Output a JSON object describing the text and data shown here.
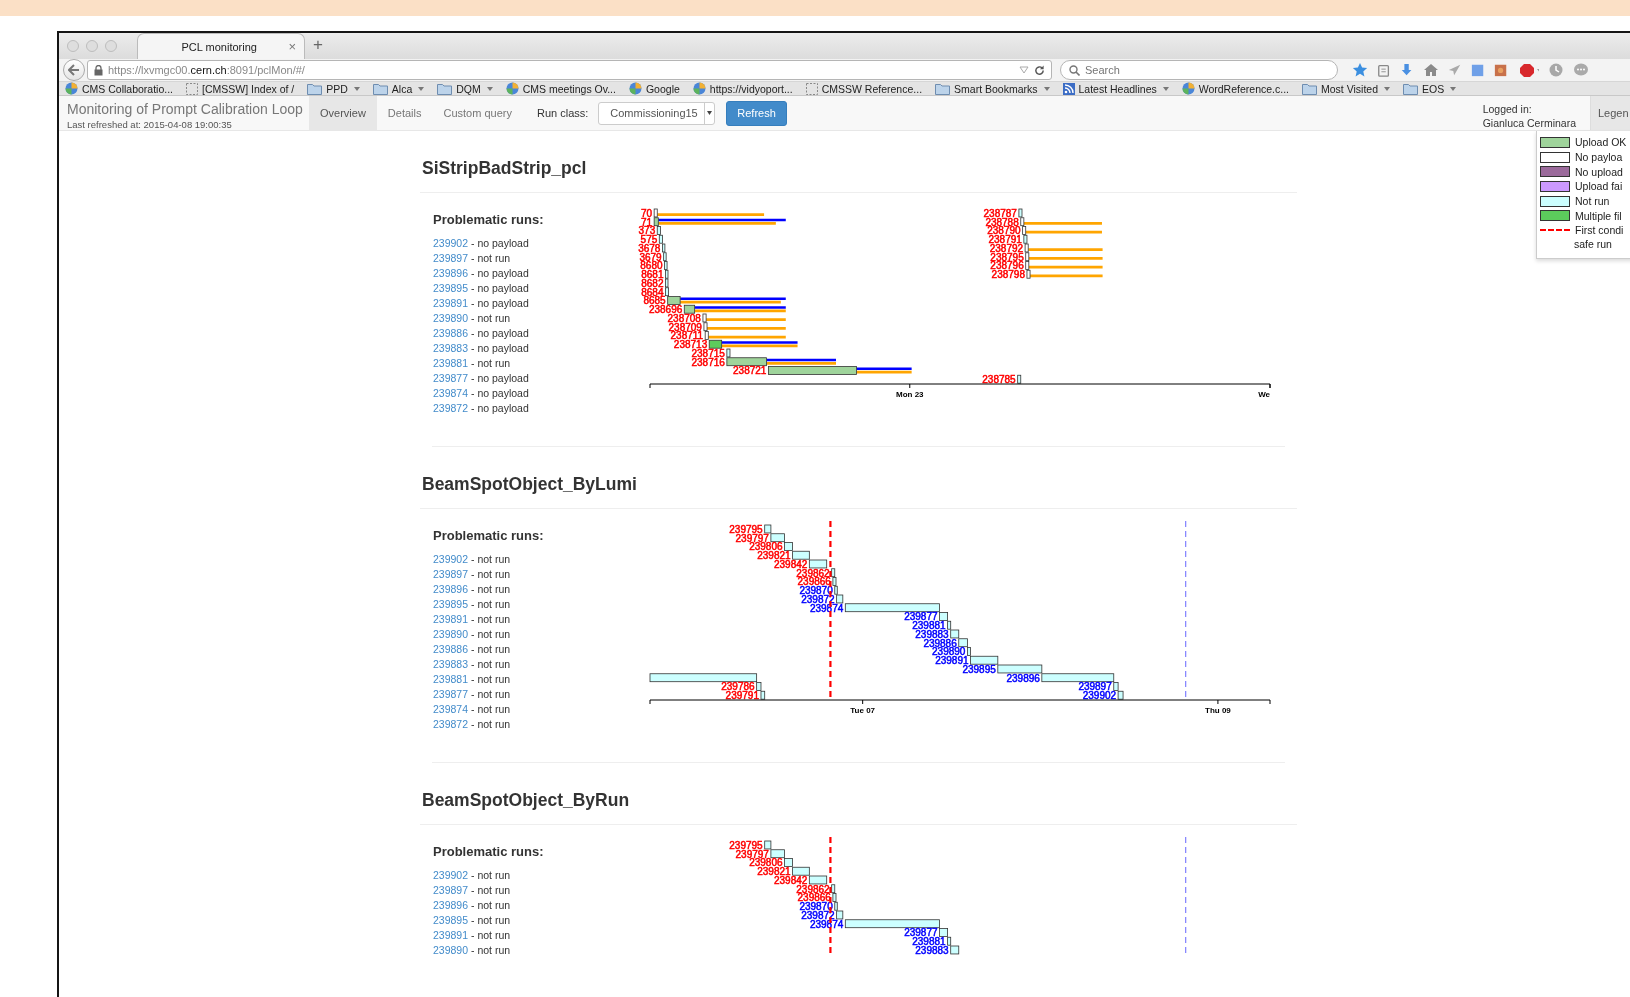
{
  "browser": {
    "tab_title": "PCL monitoring",
    "close": "×",
    "new_tab": "+",
    "url": {
      "prefix": "https://lxvmgc00.",
      "domain": "cern.ch",
      "suffix": ":8091/pclMon/#/"
    },
    "search": {
      "placeholder": "Search"
    },
    "bookmarks": [
      {
        "label": "CMS Collaboratio...",
        "kind": "site",
        "menu": false
      },
      {
        "label": "[CMSSW] Index of /",
        "kind": "page",
        "menu": false
      },
      {
        "label": "PPD",
        "kind": "folder",
        "menu": true
      },
      {
        "label": "Alca",
        "kind": "folder",
        "menu": true
      },
      {
        "label": "DQM",
        "kind": "folder",
        "menu": true
      },
      {
        "label": "CMS meetings Ov...",
        "kind": "site",
        "menu": false
      },
      {
        "label": "Google",
        "kind": "site",
        "menu": false
      },
      {
        "label": "https://vidyoport...",
        "kind": "site",
        "menu": false
      },
      {
        "label": "CMSSW Reference...",
        "kind": "page",
        "menu": false
      },
      {
        "label": "Smart Bookmarks",
        "kind": "folder",
        "menu": true
      },
      {
        "label": "Latest Headlines",
        "kind": "feed",
        "menu": true
      },
      {
        "label": "WordReference.c...",
        "kind": "site",
        "menu": false
      },
      {
        "label": "Most Visited",
        "kind": "folder",
        "menu": true
      },
      {
        "label": "EOS",
        "kind": "folder",
        "menu": true
      }
    ]
  },
  "app": {
    "title": "Monitoring of Prompt Calibration Loop",
    "refreshed": "Last refreshed at: 2015-04-08 19:00:35",
    "tabs": [
      {
        "label": "Overview",
        "selected": true
      },
      {
        "label": "Details",
        "selected": false
      },
      {
        "label": "Custom query",
        "selected": false
      }
    ],
    "run_class_label": "Run class:",
    "run_class_value": "Commissioning15",
    "refresh_button": "Refresh",
    "logged_in_label": "Logged in:",
    "user": "Gianluca Cerminara",
    "legend_tab": "Legen"
  },
  "legend": [
    {
      "kind": "swatch",
      "label": "Upload OK",
      "color": "#9fd49b"
    },
    {
      "kind": "swatch",
      "label": "No payloa",
      "color": "#ffffff"
    },
    {
      "kind": "swatch",
      "label": "No upload",
      "color": "#9b6a9b"
    },
    {
      "kind": "swatch",
      "label": "Upload fai",
      "color": "#cc99ff"
    },
    {
      "kind": "swatch",
      "label": "Not run",
      "color": "#ccffff"
    },
    {
      "kind": "swatch",
      "label": "Multiple fil",
      "color": "#5ccc5c"
    },
    {
      "kind": "dash",
      "label": "First condi",
      "label2": "safe run",
      "color": "#ff0000"
    }
  ],
  "sections": [
    {
      "title": "SiStripBadStrip_pcl",
      "heading": "Problematic runs:",
      "runs": [
        {
          "run": "239902",
          "status": "- no payload"
        },
        {
          "run": "239897",
          "status": "- not run"
        },
        {
          "run": "239896",
          "status": "- no payload"
        },
        {
          "run": "239895",
          "status": "- no payload"
        },
        {
          "run": "239891",
          "status": "- no payload"
        },
        {
          "run": "239890",
          "status": "- not run"
        },
        {
          "run": "239886",
          "status": "- no payload"
        },
        {
          "run": "239883",
          "status": "- no payload"
        },
        {
          "run": "239881",
          "status": "- not run"
        },
        {
          "run": "239877",
          "status": "- no payload"
        },
        {
          "run": "239874",
          "status": "- no payload"
        },
        {
          "run": "239872",
          "status": "- no payload"
        }
      ],
      "timeline": {
        "axis_labels": [
          "Mon 23",
          "We"
        ],
        "bars": [
          {
            "label": "70",
            "kind": "no_payload",
            "color": "#ff0000"
          },
          {
            "label": "238787",
            "kind": "not_run",
            "color": "#ff0000"
          },
          {
            "label": "71",
            "kind": "upload_ok",
            "color": "#ff0000"
          },
          {
            "label": "238788",
            "kind": "no_payload",
            "color": "#ff0000"
          },
          {
            "label": "373",
            "kind": "not_run",
            "color": "#ff0000"
          },
          {
            "label": "238790",
            "kind": "no_payload",
            "color": "#ff0000"
          },
          {
            "label": "575",
            "kind": "not_run",
            "color": "#ff0000"
          },
          {
            "label": "238791",
            "kind": "not_run",
            "color": "#ff0000"
          },
          {
            "label": "3678",
            "kind": "not_run",
            "color": "#ff0000"
          },
          {
            "label": "238792",
            "kind": "no_payload",
            "color": "#ff0000"
          },
          {
            "label": "3679",
            "kind": "not_run",
            "color": "#ff0000"
          },
          {
            "label": "238795",
            "kind": "no_payload",
            "color": "#ff0000"
          },
          {
            "label": "8680",
            "kind": "not_run",
            "color": "#ff0000"
          },
          {
            "label": "238796",
            "kind": "no_payload",
            "color": "#ff0000"
          },
          {
            "label": "8681",
            "kind": "not_run",
            "color": "#ff0000"
          },
          {
            "label": "238798",
            "kind": "no_payload",
            "color": "#ff0000"
          },
          {
            "label": "8682",
            "kind": "not_run",
            "color": "#ff0000"
          },
          {
            "label": "8684",
            "kind": "not_run",
            "color": "#ff0000"
          },
          {
            "label": "8685",
            "kind": "upload_ok",
            "color": "#ff0000"
          },
          {
            "label": "238696",
            "kind": "upload_ok",
            "color": "#ff0000"
          },
          {
            "label": "238708",
            "kind": "no_payload",
            "color": "#ff0000"
          },
          {
            "label": "238709",
            "kind": "no_payload",
            "color": "#ff0000"
          },
          {
            "label": "238711",
            "kind": "no_payload",
            "color": "#ff0000"
          },
          {
            "label": "238713",
            "kind": "multiple",
            "color": "#ff0000"
          },
          {
            "label": "238715",
            "kind": "not_run",
            "color": "#ff0000"
          },
          {
            "label": "238716",
            "kind": "upload_ok",
            "color": "#ff0000"
          },
          {
            "label": "238721",
            "kind": "upload_ok",
            "color": "#ff0000"
          },
          {
            "label": "238785",
            "kind": "not_run",
            "color": "#ff0000"
          }
        ]
      }
    },
    {
      "title": "BeamSpotObject_ByLumi",
      "heading": "Problematic runs:",
      "runs": [
        {
          "run": "239902",
          "status": "- not run"
        },
        {
          "run": "239897",
          "status": "- not run"
        },
        {
          "run": "239896",
          "status": "- not run"
        },
        {
          "run": "239895",
          "status": "- not run"
        },
        {
          "run": "239891",
          "status": "- not run"
        },
        {
          "run": "239890",
          "status": "- not run"
        },
        {
          "run": "239886",
          "status": "- not run"
        },
        {
          "run": "239883",
          "status": "- not run"
        },
        {
          "run": "239881",
          "status": "- not run"
        },
        {
          "run": "239877",
          "status": "- not run"
        },
        {
          "run": "239874",
          "status": "- not run"
        },
        {
          "run": "239872",
          "status": "- not run"
        }
      ],
      "timeline": {
        "axis_labels": [
          "Tue 07",
          "Thu 09"
        ],
        "bars": [
          {
            "label": "239795",
            "kind": "not_run",
            "color": "#ff0000"
          },
          {
            "label": "239797",
            "kind": "not_run",
            "color": "#ff0000"
          },
          {
            "label": "239806",
            "kind": "not_run",
            "color": "#ff0000"
          },
          {
            "label": "239821",
            "kind": "not_run",
            "color": "#ff0000"
          },
          {
            "label": "239842",
            "kind": "not_run",
            "color": "#ff0000"
          },
          {
            "label": "239862",
            "kind": "not_run",
            "color": "#ff0000"
          },
          {
            "label": "239866",
            "kind": "not_run",
            "color": "#ff0000"
          },
          {
            "label": "239870",
            "kind": "not_run",
            "color": "#0000ff"
          },
          {
            "label": "239872",
            "kind": "not_run",
            "color": "#0000ff"
          },
          {
            "label": "239874",
            "kind": "not_run",
            "color": "#0000ff"
          },
          {
            "label": "239877",
            "kind": "not_run",
            "color": "#0000ff"
          },
          {
            "label": "239881",
            "kind": "not_run",
            "color": "#0000ff"
          },
          {
            "label": "239883",
            "kind": "not_run",
            "color": "#0000ff"
          },
          {
            "label": "239886",
            "kind": "not_run",
            "color": "#0000ff"
          },
          {
            "label": "239890",
            "kind": "not_run",
            "color": "#0000ff"
          },
          {
            "label": "239891",
            "kind": "not_run",
            "color": "#0000ff"
          },
          {
            "label": "239895",
            "kind": "not_run",
            "color": "#0000ff"
          },
          {
            "kind": "not_run"
          },
          {
            "label": "239896",
            "kind": "not_run",
            "color": "#0000ff"
          },
          {
            "label": "239786",
            "kind": "not_run",
            "color": "#ff0000"
          },
          {
            "label": "239897",
            "kind": "not_run",
            "color": "#0000ff"
          },
          {
            "label": "239791",
            "kind": "not_run",
            "color": "#ff0000"
          },
          {
            "label": "239902",
            "kind": "not_run",
            "color": "#0000ff"
          }
        ]
      }
    },
    {
      "title": "BeamSpotObject_ByRun",
      "heading": "Problematic runs:",
      "runs": [
        {
          "run": "239902",
          "status": "- not run"
        },
        {
          "run": "239897",
          "status": "- not run"
        },
        {
          "run": "239896",
          "status": "- not run"
        },
        {
          "run": "239895",
          "status": "- not run"
        },
        {
          "run": "239891",
          "status": "- not run"
        },
        {
          "run": "239890",
          "status": "- not run"
        }
      ],
      "timeline": {
        "bars": [
          {
            "label": "239795",
            "kind": "not_run",
            "color": "#ff0000"
          },
          {
            "label": "239797",
            "kind": "not_run",
            "color": "#ff0000"
          },
          {
            "label": "239806",
            "kind": "not_run",
            "color": "#ff0000"
          },
          {
            "label": "239821",
            "kind": "not_run",
            "color": "#ff0000"
          },
          {
            "label": "239842",
            "kind": "not_run",
            "color": "#ff0000"
          },
          {
            "label": "239862",
            "kind": "not_run",
            "color": "#ff0000"
          },
          {
            "label": "239866",
            "kind": "not_run",
            "color": "#ff0000"
          },
          {
            "label": "239870",
            "kind": "not_run",
            "color": "#0000ff"
          },
          {
            "label": "239872",
            "kind": "not_run",
            "color": "#0000ff"
          },
          {
            "label": "239874",
            "kind": "not_run",
            "color": "#0000ff"
          },
          {
            "label": "239877",
            "kind": "not_run",
            "color": "#0000ff"
          },
          {
            "label": "239881",
            "kind": "not_run",
            "color": "#0000ff"
          },
          {
            "label": "239883",
            "kind": "not_run",
            "color": "#0000ff"
          }
        ]
      }
    }
  ]
}
